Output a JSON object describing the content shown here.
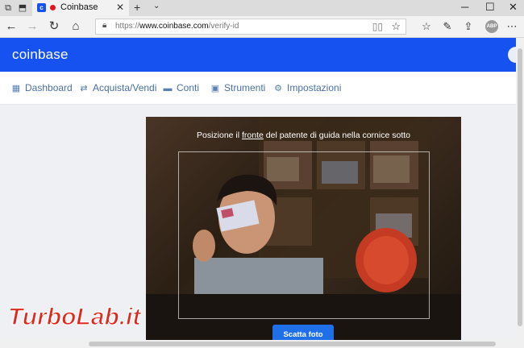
{
  "browser": {
    "tab_title": "Coinbase",
    "tab_favicon_letter": "c",
    "url_prefix": "https://",
    "url_domain": "www.coinbase.com",
    "url_path": "/verify-id",
    "abp_label": "ABP"
  },
  "app": {
    "logo": "coinbase",
    "brand_color": "#1652f0"
  },
  "nav": {
    "items": [
      {
        "label": "Dashboard",
        "icon": "dashboard-icon"
      },
      {
        "label": "Acquista/Vendi",
        "icon": "swap-arrows-icon"
      },
      {
        "label": "Conti",
        "icon": "wallet-icon"
      },
      {
        "label": "Strumenti",
        "icon": "briefcase-icon"
      },
      {
        "label": "Impostazioni",
        "icon": "gear-icon"
      }
    ]
  },
  "verify": {
    "instruction_before": "Posizione il ",
    "instruction_link": "fronte",
    "instruction_after": " del patente di guida nella cornice sotto",
    "button_label": "Scatta foto"
  },
  "watermark": {
    "text": "TurboLab.it"
  }
}
